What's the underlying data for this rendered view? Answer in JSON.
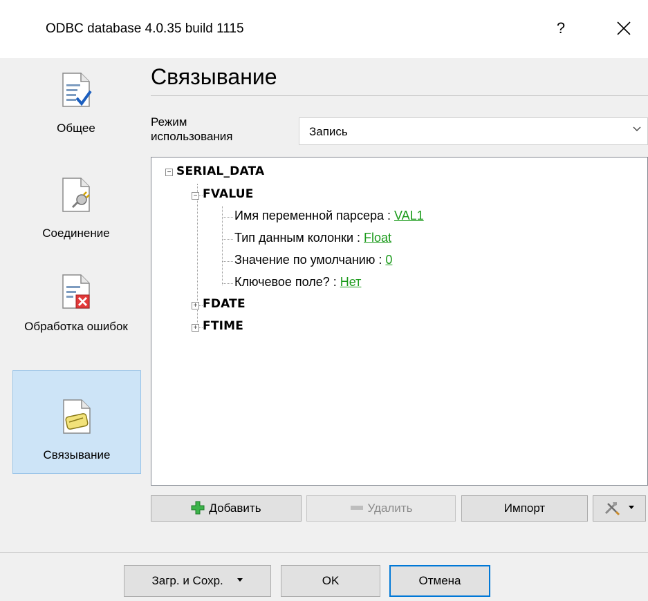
{
  "window": {
    "title": "ODBC database 4.0.35 build 1115",
    "help_label": "?",
    "close_label": "✕"
  },
  "sidebar": {
    "items": [
      {
        "label": "Общее",
        "icon": "general-document-check-icon"
      },
      {
        "label": "Соединение",
        "icon": "connection-plug-icon"
      },
      {
        "label": "Обработка ошибок",
        "icon": "error-handling-icon"
      },
      {
        "label": "Связывание",
        "icon": "binding-clip-icon",
        "active": true
      }
    ]
  },
  "main": {
    "heading": "Связывание",
    "mode_label": "Режим использования",
    "mode_value": "Запись",
    "tree": {
      "root": "SERIAL_DATA",
      "fvalue": "FVALUE",
      "props": [
        {
          "label": "Имя переменной парсера : ",
          "value": "VAL1"
        },
        {
          "label": "Тип данным колонки : ",
          "value": "Float"
        },
        {
          "label": "Значение по умолчанию : ",
          "value": "0"
        },
        {
          "label": "Ключевое поле? : ",
          "value": "Нет"
        }
      ],
      "fdate": "FDATE",
      "ftime": "FTIME"
    },
    "toolbar": {
      "add_label": "Добавить",
      "delete_label": "Удалить",
      "import_label": "Импорт",
      "tools_icon": "tools-icon"
    }
  },
  "footer": {
    "load_save_label": "Загр. и Сохр.",
    "ok_label": "OK",
    "cancel_label": "Отмена"
  },
  "colors": {
    "accent": "#0078d7",
    "active_bg": "#cde4f7",
    "link": "#1a9a1a"
  }
}
